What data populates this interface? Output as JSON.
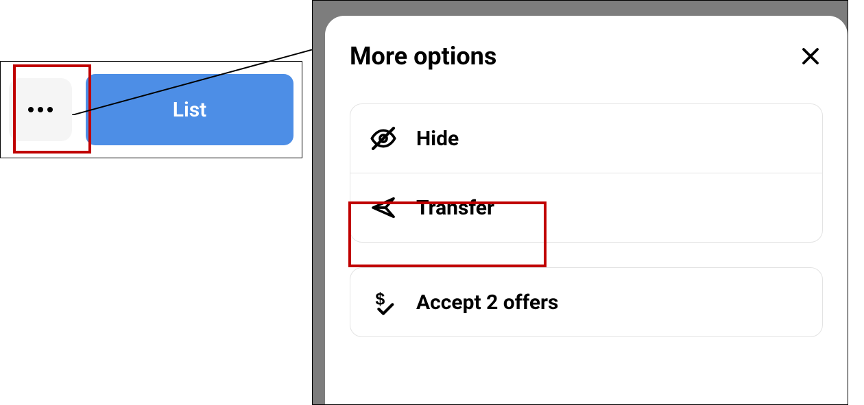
{
  "toolbar": {
    "list_label": "List"
  },
  "modal": {
    "title": "More options",
    "options": {
      "hide": "Hide",
      "transfer": "Transfer",
      "accept_offers": "Accept 2 offers"
    }
  }
}
